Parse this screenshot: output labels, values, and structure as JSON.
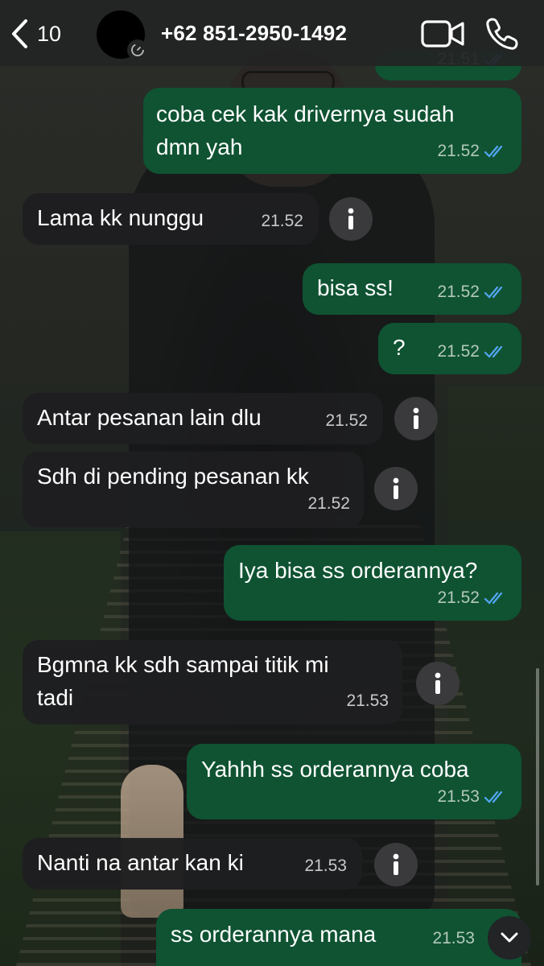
{
  "header": {
    "unread_count": "10",
    "contact_name": "+62 851-2950-1492"
  },
  "colors": {
    "outgoing_bubble": "#0f5332",
    "incoming_bubble": "#1e1e20",
    "read_ticks": "#53a6f4"
  },
  "messages": [
    {
      "dir": "out",
      "text": "",
      "time": "21.51",
      "read": true
    },
    {
      "dir": "out",
      "text": "coba cek kak drivernya sudah\ndmn yah",
      "time": "21.52",
      "read": true
    },
    {
      "dir": "in",
      "text": "Lama kk nunggu",
      "time": "21.52"
    },
    {
      "dir": "out",
      "text": "bisa ss!",
      "time": "21.52",
      "read": true
    },
    {
      "dir": "out",
      "text": "?",
      "time": "21.52",
      "read": true
    },
    {
      "dir": "in",
      "text": "Antar pesanan lain dlu",
      "time": "21.52"
    },
    {
      "dir": "in",
      "text": "Sdh di pending pesanan kk",
      "time": "21.52"
    },
    {
      "dir": "out",
      "text": "Iya bisa ss orderannya?",
      "time": "21.52",
      "read": true
    },
    {
      "dir": "in",
      "text": "Bgmna kk sdh sampai titik mi\ntadi",
      "time": "21.53"
    },
    {
      "dir": "out",
      "text": "Yahhh ss orderannya coba",
      "time": "21.53",
      "read": true
    },
    {
      "dir": "in",
      "text": "Nanti na antar kan ki",
      "time": "21.53"
    },
    {
      "dir": "out",
      "text": "ss orderannya mana",
      "time": "21.53",
      "read": true
    }
  ]
}
